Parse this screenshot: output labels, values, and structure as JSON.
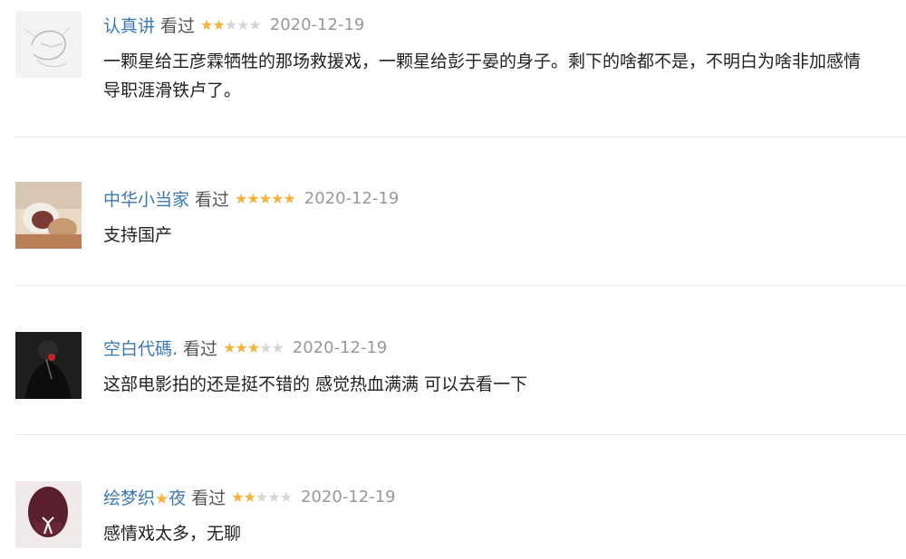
{
  "reviews": [
    {
      "username": "认真讲",
      "username_star": "",
      "username_suffix": "",
      "status": "看过",
      "rating": 2,
      "date": "2020-12-19",
      "comment_lines": [
        "一颗星给王彦霖牺牲的那场救援戏，一颗星给彭于晏的身子。剩下的啥都不是，不明白为啥非加感情",
        "导职涯滑铁卢了。"
      ]
    },
    {
      "username": "中华小当家",
      "username_star": "",
      "username_suffix": "",
      "status": "看过",
      "rating": 5,
      "date": "2020-12-19",
      "comment_lines": [
        "支持国产"
      ]
    },
    {
      "username": "空白代碼.",
      "username_star": "",
      "username_suffix": "",
      "status": "看过",
      "rating": 3,
      "date": "2020-12-19",
      "comment_lines": [
        "这部电影拍的还是挺不错的 感觉热血满满 可以去看一下"
      ]
    },
    {
      "username": "绘梦织",
      "username_star": "★",
      "username_suffix": "夜",
      "status": "看过",
      "rating": 2,
      "date": "2020-12-19",
      "comment_lines": [
        "感情戏太多，无聊"
      ]
    }
  ],
  "icons": {
    "star_filled": "★",
    "star_empty": "★"
  },
  "colors": {
    "username": "#3d79b1",
    "star_on": "#f4b43c",
    "star_off": "#d6d6d6",
    "date": "#999999",
    "divider": "#e8e8e8"
  }
}
